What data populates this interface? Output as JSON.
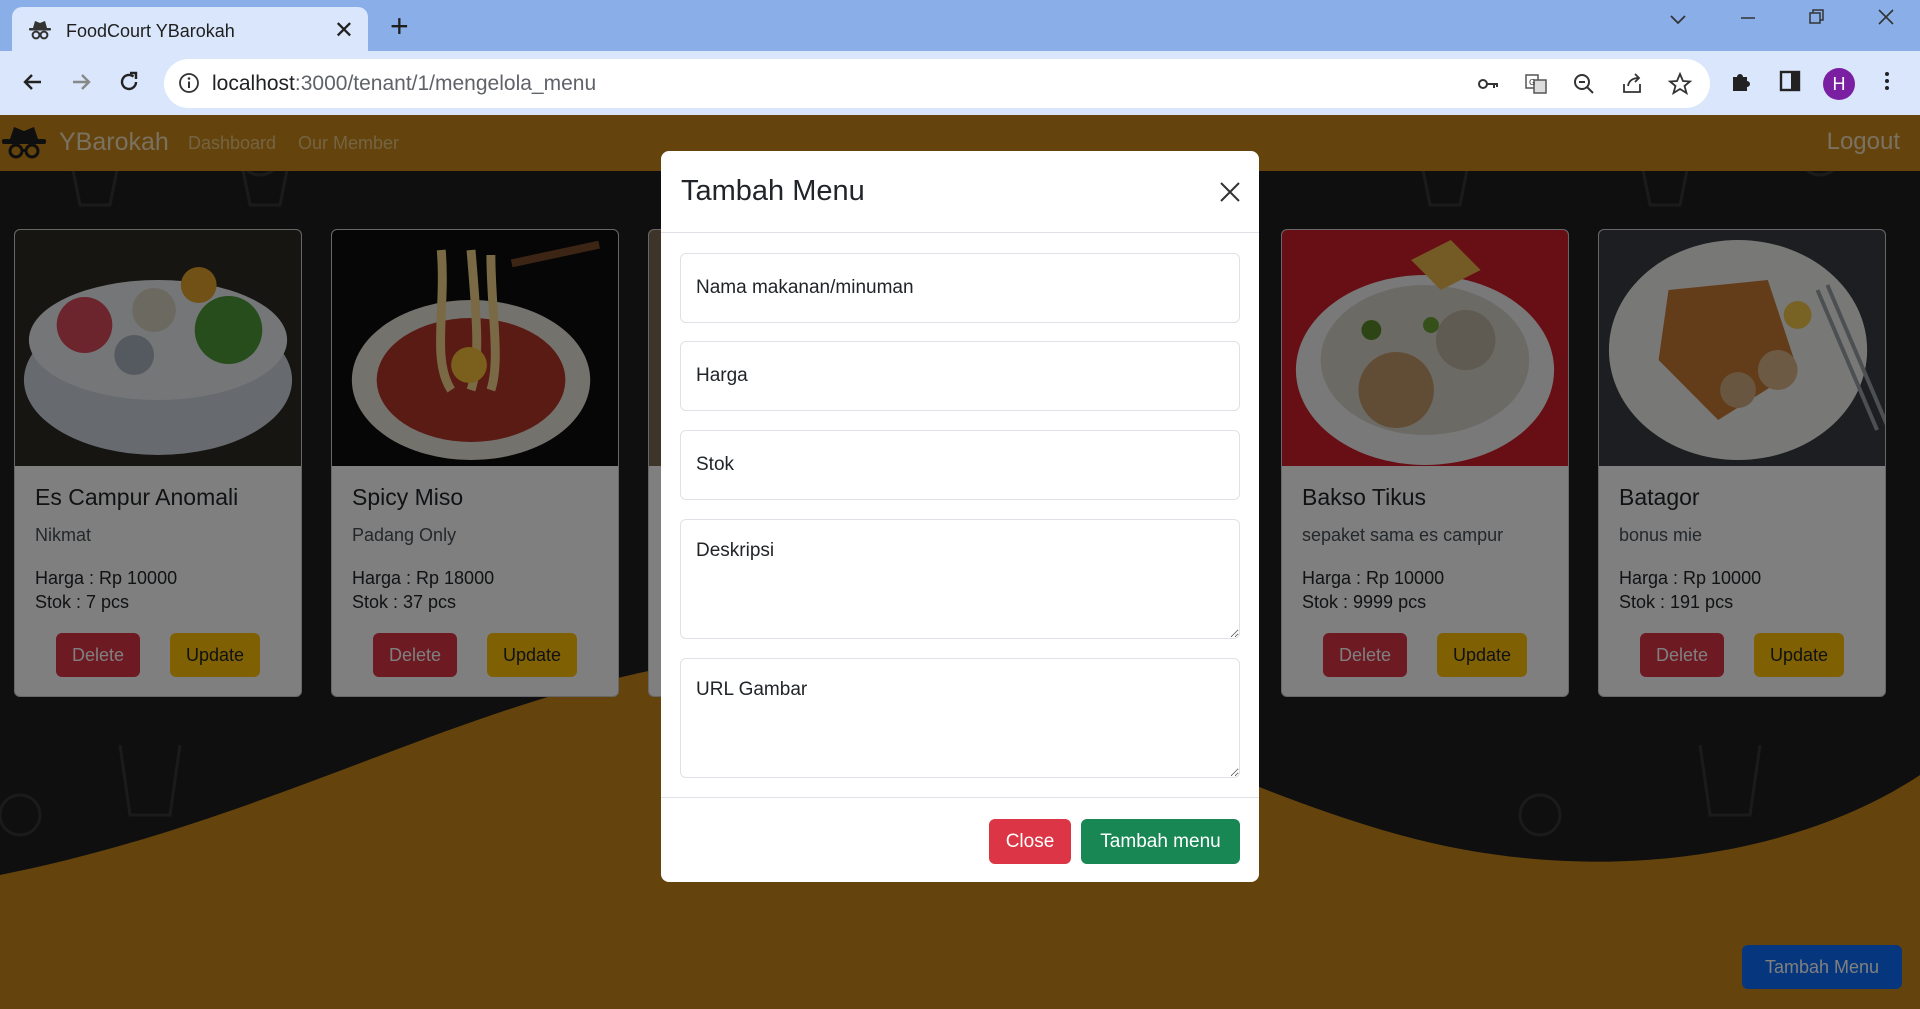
{
  "browser": {
    "tab_title": "FoodCourt YBarokah",
    "url_host": "localhost",
    "url_path": ":3000/tenant/1/mengelola_menu",
    "profile_initial": "H"
  },
  "navbar": {
    "brand": "YBarokah",
    "links": [
      "Dashboard",
      "Our Member"
    ],
    "logout": "Logout"
  },
  "menu_items": [
    {
      "name": "Es Campur Anomali",
      "description": "Nikmat",
      "price": "Harga : Rp 10000",
      "stock": "Stok : 7 pcs",
      "delete_label": "Delete",
      "update_label": "Update"
    },
    {
      "name": "Spicy Miso",
      "description": "Padang Only",
      "price": "Harga : Rp 18000",
      "stock": "Stok : 37 pcs",
      "delete_label": "Delete",
      "update_label": "Update"
    },
    {
      "name": "Bakso Tikus",
      "description": "sepaket sama es campur",
      "price": "Harga : Rp 10000",
      "stock": "Stok : 9999 pcs",
      "delete_label": "Delete",
      "update_label": "Update"
    },
    {
      "name": "Batagor",
      "description": "bonus mie",
      "price": "Harga : Rp 10000",
      "stock": "Stok : 191 pcs",
      "delete_label": "Delete",
      "update_label": "Update"
    }
  ],
  "add_menu_button": "Tambah Menu",
  "modal": {
    "title": "Tambah Menu",
    "fields": {
      "name_placeholder": "Nama makanan/minuman",
      "price_placeholder": "Harga",
      "stock_placeholder": "Stok",
      "description_placeholder": "Deskripsi",
      "image_url_placeholder": "URL Gambar"
    },
    "close_label": "Close",
    "submit_label": "Tambah menu"
  },
  "colors": {
    "navbar": "#c8871a",
    "danger": "#dc3545",
    "warning": "#ffc107",
    "success": "#198754",
    "primary": "#0d6efd"
  }
}
